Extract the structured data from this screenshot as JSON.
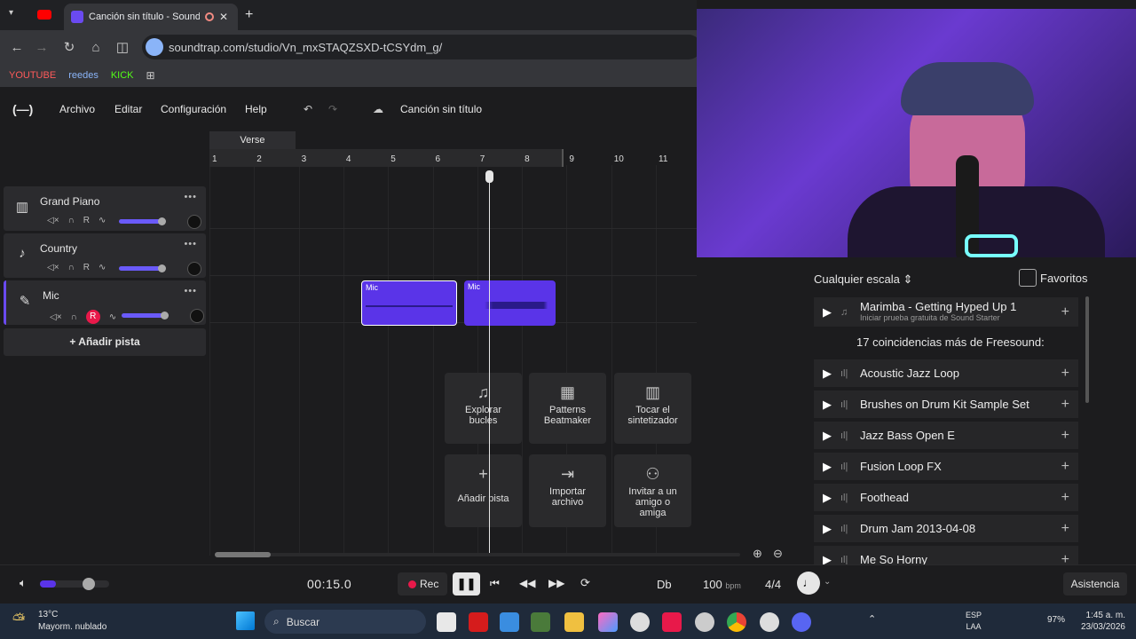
{
  "browser": {
    "tab_title": "Canción sin título - Soundtr",
    "url": "soundtrap.com/studio/Vn_mxSTAQZSXD-tCSYdm_g/",
    "bookmarks": [
      "YOUTUBE",
      "reedes",
      "KICK"
    ]
  },
  "app": {
    "menu": [
      "Archivo",
      "Editar",
      "Configuración",
      "Help"
    ],
    "song_title": "Canción sin título",
    "section_label": "Verse"
  },
  "ruler": [
    "1",
    "2",
    "3",
    "4",
    "5",
    "6",
    "7",
    "8",
    "9",
    "10",
    "11"
  ],
  "tracks": [
    {
      "name": "Grand Piano",
      "icon": "piano-icon"
    },
    {
      "name": "Country",
      "icon": "guitar-icon"
    },
    {
      "name": "Mic",
      "icon": "mic-icon",
      "rec": "R"
    }
  ],
  "track_ctrl_r": "R",
  "add_track": "+ Añadir pista",
  "clips": [
    "Mic",
    "Mic"
  ],
  "cards": [
    {
      "label": "Explorar bucles",
      "icon": "music-note-icon"
    },
    {
      "label": "Patterns Beatmaker",
      "icon": "grid-icon"
    },
    {
      "label": "Tocar el sintetizador",
      "icon": "keyboard-icon"
    },
    {
      "label": "Añadir pista",
      "icon": "plus-icon"
    },
    {
      "label": "Importar archivo",
      "icon": "import-icon"
    },
    {
      "label": "Invitar a un amigo o amiga",
      "icon": "invite-icon"
    }
  ],
  "panel": {
    "scale": "Cualquier escala",
    "favorites": "Favoritos",
    "featured_title": "Marimba - Getting Hyped Up 1",
    "featured_sub": "Iniciar prueba gratuita de Sound Starter",
    "matches": "17 coincidencias más de Freesound:",
    "loops": [
      "Acoustic Jazz Loop",
      "Brushes on Drum Kit Sample Set",
      "Jazz Bass Open E",
      "Fusion Loop FX",
      "Foothead",
      "Drum Jam 2013-04-08",
      "Me So Horny"
    ]
  },
  "transport": {
    "time": "00:15.0",
    "rec": "Rec",
    "key": "Db",
    "bpm": "100",
    "bpm_unit": "bpm",
    "signature": "4/4",
    "help": "Asistencia",
    "master_volume": 0.78
  },
  "taskbar": {
    "weather_temp": "13°C",
    "weather_desc": "Mayorm. nublado",
    "search": "Buscar",
    "lang1": "ESP",
    "lang2": "LAA",
    "battery": "97%",
    "time": "1:45 a. m.",
    "date": "23/03/2026"
  },
  "colors": {
    "accent": "#5a34e8",
    "rec": "#e8194a"
  }
}
